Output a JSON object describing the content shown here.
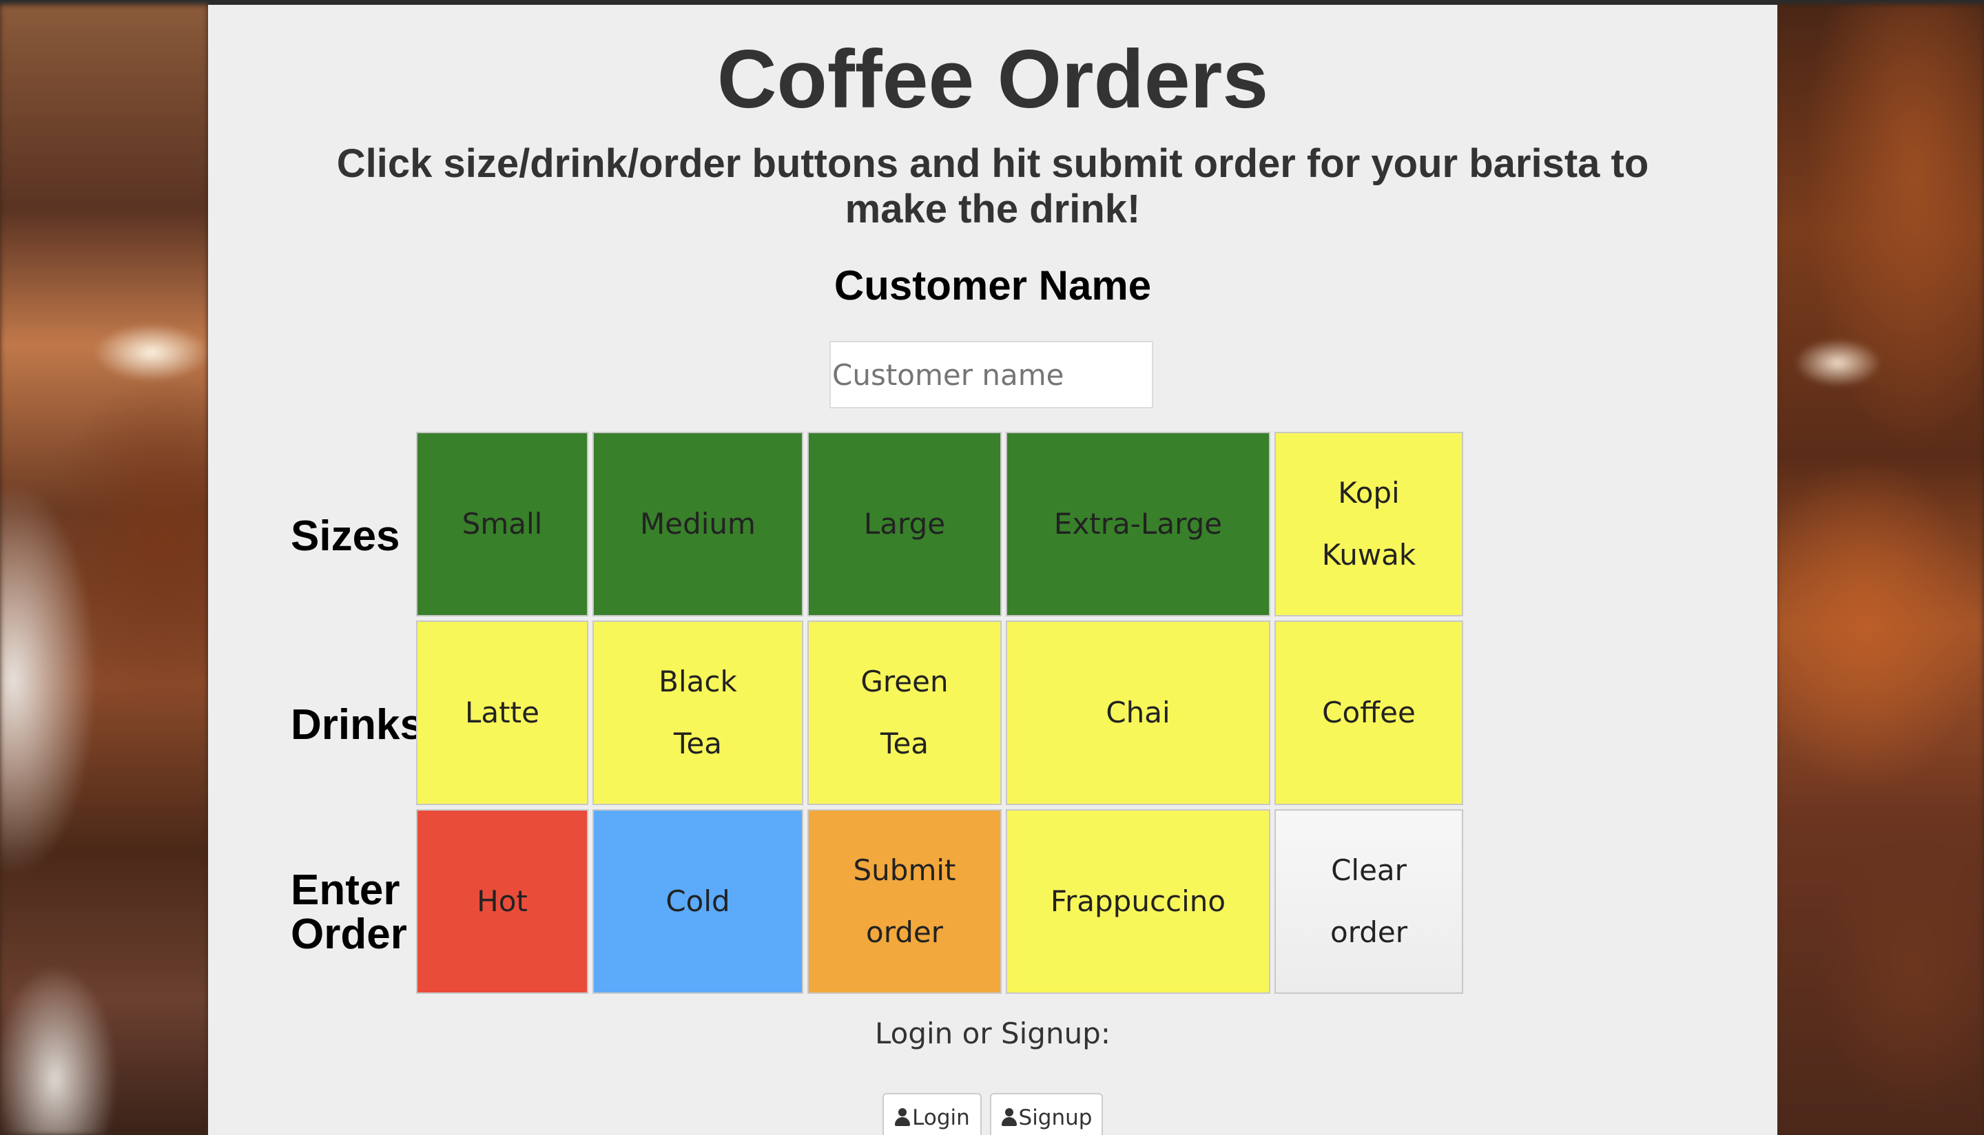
{
  "page": {
    "title": "Coffee Orders",
    "subtitle": "Click size/drink/order buttons and hit submit order for your barista to make the drink!",
    "customer_heading": "Customer Name",
    "customer_input": {
      "placeholder": "Customer name",
      "value": ""
    }
  },
  "rows": {
    "sizes": {
      "label": "Sizes",
      "buttons": [
        "Small",
        "Medium",
        "Large",
        "Extra-Large",
        "Kopi Kuwak"
      ]
    },
    "drinks": {
      "label": "Drinks",
      "buttons": [
        "Latte",
        "Black Tea",
        "Green Tea",
        "Chai",
        "Coffee"
      ]
    },
    "order": {
      "label_line1": "Enter",
      "label_line2": "Order",
      "buttons": [
        "Hot",
        "Cold",
        "Submit order",
        "Frappuccino",
        "Clear order"
      ]
    }
  },
  "auth": {
    "prompt": "Login or Signup:",
    "login_label": "Login",
    "signup_label": "Signup"
  },
  "colors": {
    "green": "#38802a",
    "yellow": "#f8f75a",
    "red": "#ea4c3a",
    "blue": "#5caafa",
    "orange": "#f2a83c",
    "clear": "#f2f2f2"
  }
}
